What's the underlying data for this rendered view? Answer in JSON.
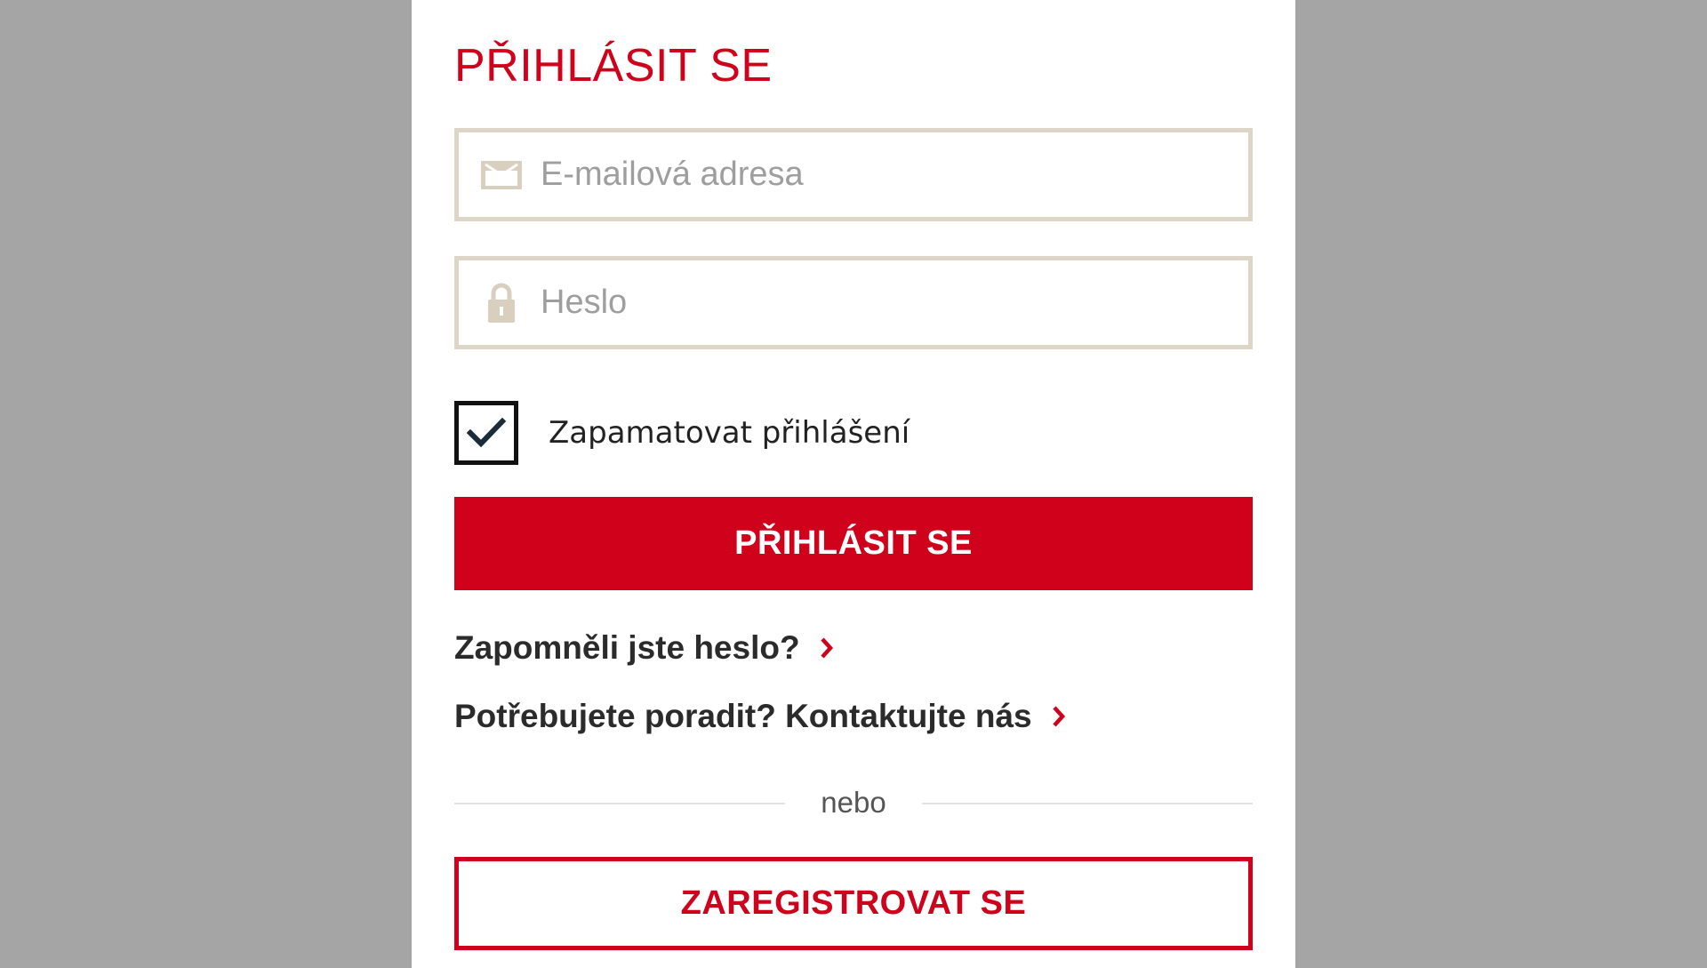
{
  "login": {
    "title": "PŘIHLÁSIT SE",
    "email": {
      "placeholder": "E-mailová adresa",
      "value": "",
      "icon": "envelope-icon"
    },
    "password": {
      "placeholder": "Heslo",
      "value": "",
      "icon": "lock-icon"
    },
    "remember": {
      "label": "Zapamatovat přihlášení",
      "checked": true
    },
    "submit_label": "PŘIHLÁSIT SE",
    "forgot_link": "Zapomněli jste heslo?",
    "contact_link": "Potřebujete poradit? Kontaktujte nás",
    "divider_text": "nebo",
    "register_label": "ZAREGISTROVAT SE"
  },
  "colors": {
    "brand_red": "#d0021b",
    "field_border": "#ddd6c8",
    "backdrop": "#a5a5a5",
    "panel": "#ffffff"
  }
}
